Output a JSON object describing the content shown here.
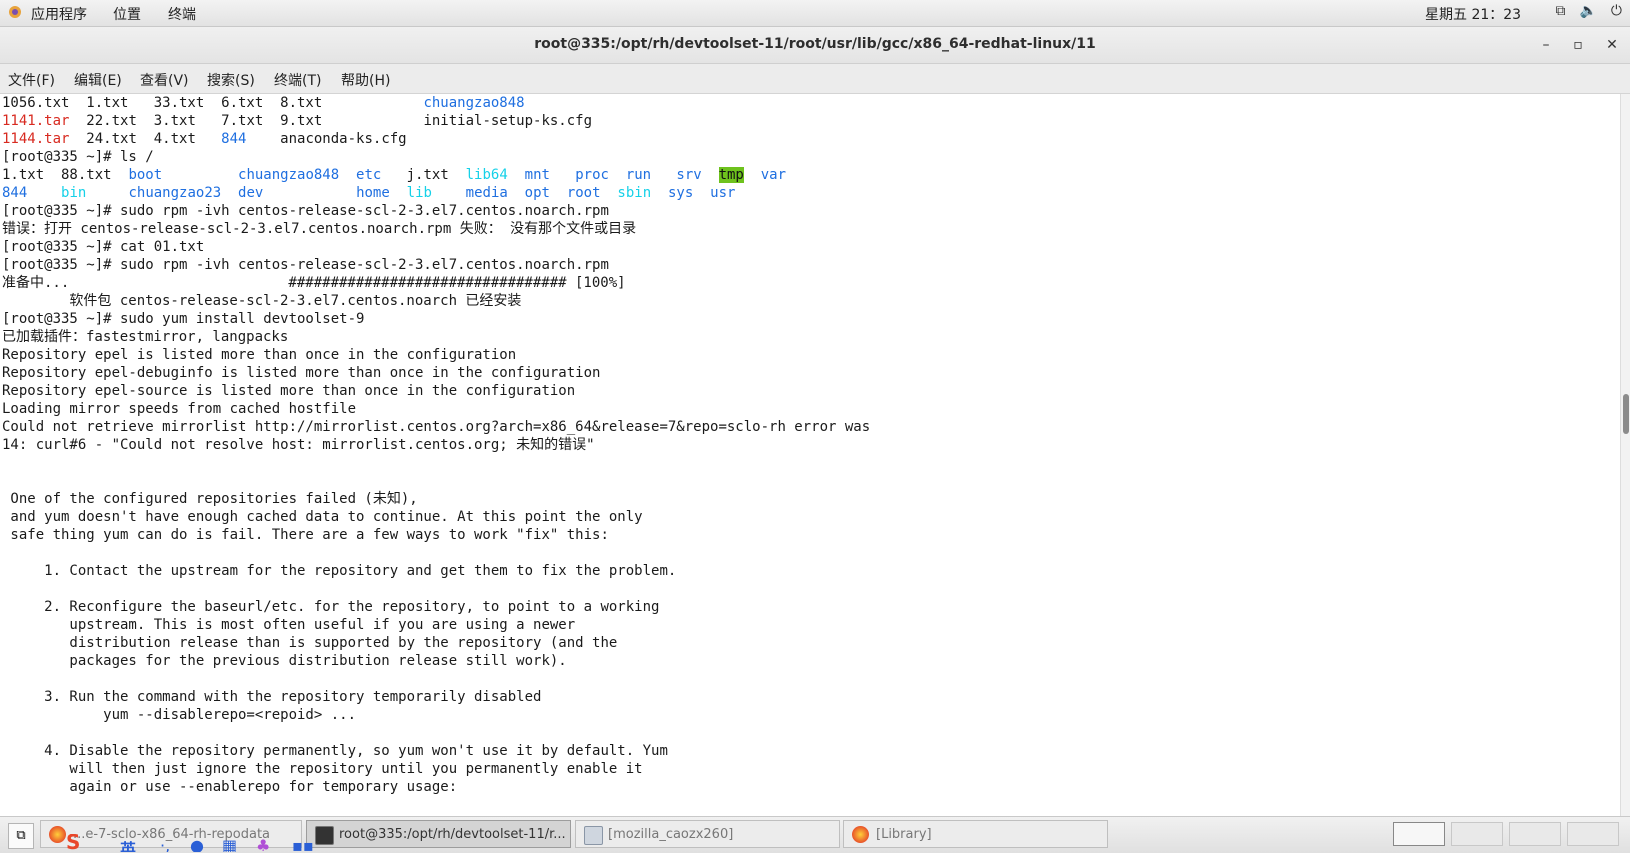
{
  "topbar": {
    "apps": "应用程序",
    "places": "位置",
    "terminal": "终端",
    "clock": "星期五 21：23",
    "tray_icons": [
      "network-icon",
      "volume-icon",
      "power-icon"
    ]
  },
  "window": {
    "title": "root@335:/opt/rh/devtoolset-11/root/usr/lib/gcc/x86_64-redhat-linux/11",
    "minimize": "–",
    "maximize": "▫",
    "close": "✕"
  },
  "menubar": [
    {
      "label": "文件(F)"
    },
    {
      "label": "编辑(E)"
    },
    {
      "label": "查看(V)"
    },
    {
      "label": "搜索(S)"
    },
    {
      "label": "终端(T)"
    },
    {
      "label": "帮助(H)"
    }
  ],
  "terminal": {
    "lines": [
      [
        [
          "1056.txt  1.txt   33.txt  6.txt  8.txt            ",
          ""
        ],
        [
          "chuangzao848",
          "blue"
        ]
      ],
      [
        [
          "1141.tar",
          "red"
        ],
        [
          "  22.txt  3.txt   7.txt  9.txt            initial-setup-ks.cfg",
          ""
        ]
      ],
      [
        [
          "1144.tar",
          "red"
        ],
        [
          "  24.txt  4.txt   ",
          ""
        ],
        [
          "844",
          "blue"
        ],
        [
          "    anaconda-ks.cfg",
          ""
        ]
      ],
      [
        [
          "[root@335 ~]# ls /",
          ""
        ]
      ],
      [
        [
          "1.txt  88.txt  ",
          ""
        ],
        [
          "boot",
          "blue"
        ],
        [
          "         ",
          ""
        ],
        [
          "chuangzao848",
          "blue"
        ],
        [
          "  ",
          ""
        ],
        [
          "etc",
          "blue"
        ],
        [
          "   j.txt  ",
          ""
        ],
        [
          "lib64",
          "cyan"
        ],
        [
          "  ",
          ""
        ],
        [
          "mnt",
          "blue"
        ],
        [
          "   ",
          ""
        ],
        [
          "proc",
          "blue"
        ],
        [
          "  ",
          ""
        ],
        [
          "run",
          "blue"
        ],
        [
          "   ",
          ""
        ],
        [
          "srv",
          "blue"
        ],
        [
          "  ",
          ""
        ],
        [
          "tmp",
          "hl"
        ],
        [
          "  ",
          ""
        ],
        [
          "var",
          "blue"
        ]
      ],
      [
        [
          "844",
          "blue"
        ],
        [
          "    ",
          ""
        ],
        [
          "bin",
          "cyan"
        ],
        [
          "     ",
          ""
        ],
        [
          "chuangzao23",
          "blue"
        ],
        [
          "  ",
          ""
        ],
        [
          "dev",
          "blue"
        ],
        [
          "           ",
          ""
        ],
        [
          "home",
          "blue"
        ],
        [
          "  ",
          ""
        ],
        [
          "lib",
          "cyan"
        ],
        [
          "    ",
          ""
        ],
        [
          "media",
          "blue"
        ],
        [
          "  ",
          ""
        ],
        [
          "opt",
          "blue"
        ],
        [
          "  ",
          ""
        ],
        [
          "root",
          "blue"
        ],
        [
          "  ",
          ""
        ],
        [
          "sbin",
          "cyan"
        ],
        [
          "  ",
          ""
        ],
        [
          "sys",
          "blue"
        ],
        [
          "  ",
          ""
        ],
        [
          "usr",
          "blue"
        ]
      ],
      [
        [
          "[root@335 ~]# sudo rpm -ivh centos-release-scl-2-3.el7.centos.noarch.rpm",
          ""
        ]
      ],
      [
        [
          "错误：打开 centos-release-scl-2-3.el7.centos.noarch.rpm 失败： 没有那个文件或目录",
          ""
        ]
      ],
      [
        [
          "[root@335 ~]# cat 01.txt",
          ""
        ]
      ],
      [
        [
          "[root@335 ~]# sudo rpm -ivh centos-release-scl-2-3.el7.centos.noarch.rpm",
          ""
        ]
      ],
      [
        [
          "准备中...                          ################################# [100%]",
          ""
        ]
      ],
      [
        [
          "        软件包 centos-release-scl-2-3.el7.centos.noarch 已经安装",
          ""
        ]
      ],
      [
        [
          "[root@335 ~]# sudo yum install devtoolset-9",
          ""
        ]
      ],
      [
        [
          "已加载插件：fastestmirror, langpacks",
          ""
        ]
      ],
      [
        [
          "Repository epel is listed more than once in the configuration",
          ""
        ]
      ],
      [
        [
          "Repository epel-debuginfo is listed more than once in the configuration",
          ""
        ]
      ],
      [
        [
          "Repository epel-source is listed more than once in the configuration",
          ""
        ]
      ],
      [
        [
          "Loading mirror speeds from cached hostfile",
          ""
        ]
      ],
      [
        [
          "Could not retrieve mirrorlist http://mirrorlist.centos.org?arch=x86_64&release=7&repo=sclo-rh error was",
          ""
        ]
      ],
      [
        [
          "14: curl#6 - \"Could not resolve host: mirrorlist.centos.org; 未知的错误\"",
          ""
        ]
      ],
      [
        [
          "",
          ""
        ]
      ],
      [
        [
          "",
          ""
        ]
      ],
      [
        [
          " One of the configured repositories failed (未知),",
          ""
        ]
      ],
      [
        [
          " and yum doesn't have enough cached data to continue. At this point the only",
          ""
        ]
      ],
      [
        [
          " safe thing yum can do is fail. There are a few ways to work \"fix\" this:",
          ""
        ]
      ],
      [
        [
          "",
          ""
        ]
      ],
      [
        [
          "     1. Contact the upstream for the repository and get them to fix the problem.",
          ""
        ]
      ],
      [
        [
          "",
          ""
        ]
      ],
      [
        [
          "     2. Reconfigure the baseurl/etc. for the repository, to point to a working",
          ""
        ]
      ],
      [
        [
          "        upstream. This is most often useful if you are using a newer",
          ""
        ]
      ],
      [
        [
          "        distribution release than is supported by the repository (and the",
          ""
        ]
      ],
      [
        [
          "        packages for the previous distribution release still work).",
          ""
        ]
      ],
      [
        [
          "",
          ""
        ]
      ],
      [
        [
          "     3. Run the command with the repository temporarily disabled",
          ""
        ]
      ],
      [
        [
          "            yum --disablerepo=<repoid> ...",
          ""
        ]
      ],
      [
        [
          "",
          ""
        ]
      ],
      [
        [
          "     4. Disable the repository permanently, so yum won't use it by default. Yum",
          ""
        ]
      ],
      [
        [
          "        will then just ignore the repository until you permanently enable it",
          ""
        ]
      ],
      [
        [
          "        again or use --enablerepo for temporary usage:",
          ""
        ]
      ]
    ]
  },
  "taskbar": {
    "tasks": [
      {
        "label": "...e-7-sclo-x86_64-rh-repodata",
        "icon": "firefox-icon",
        "active": false
      },
      {
        "label": "root@335:/opt/rh/devtoolset-11/r...",
        "icon": "terminal-icon",
        "active": true
      },
      {
        "label": "[mozilla_caozx260]",
        "icon": "file-manager-icon",
        "active": false
      },
      {
        "label": "[Library]",
        "icon": "firefox-icon",
        "active": false
      }
    ],
    "workspaces": 4,
    "active_workspace": 1
  },
  "ime": {
    "logo": "S",
    "mode": "英",
    "items": [
      "punctuation-icon",
      "microphone-icon",
      "keyboard-icon",
      "skin-icon",
      "toolbox-icon"
    ]
  },
  "colors": {
    "dir_blue": "#1f6fe0",
    "link_cyan": "#16d1e8",
    "archive_red": "#d82a20",
    "sticky_bg": "#6ec21d"
  }
}
